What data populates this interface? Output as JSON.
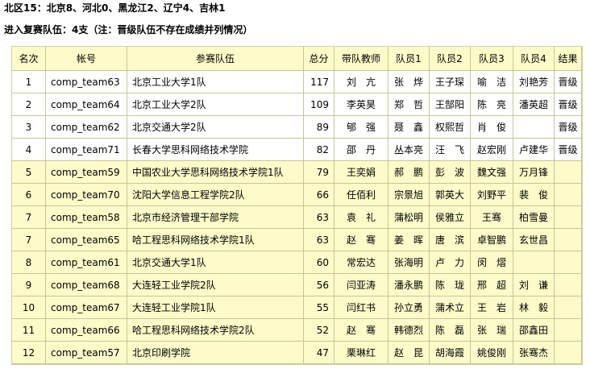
{
  "header": {
    "region_line": "北区15：北京8、河北0、黑龙江2、辽宁4、吉林1",
    "advance_line": "进入复赛队伍：4支（注：晋级队伍不存在成绩并列情况）"
  },
  "table": {
    "columns": [
      "名次",
      "帐号",
      "参赛队伍",
      "总分",
      "带队教师",
      "队员1",
      "队员2",
      "队员3",
      "队员4",
      "结果"
    ],
    "rows": [
      {
        "rank": "1",
        "account": "comp_team63",
        "team": "北京工业大学1队",
        "score": "117",
        "teacher": "刘　亢",
        "m1": "张　烨",
        "m2": "王子琛",
        "m3": "喻　洁",
        "m4": "刘艳芳",
        "result": "晋级",
        "advanced": true
      },
      {
        "rank": "2",
        "account": "comp_team64",
        "team": "北京工业大学2队",
        "score": "109",
        "teacher": "李英昊",
        "m1": "郑　哲",
        "m2": "王郜阳",
        "m3": "陈　亮",
        "m4": "潘英超",
        "result": "晋级",
        "advanced": true
      },
      {
        "rank": "3",
        "account": "comp_team62",
        "team": "北京交通大学2队",
        "score": "89",
        "teacher": "郇　强",
        "m1": "聂　鑫",
        "m2": "权熙哲",
        "m3": "肖　俊",
        "m4": "",
        "result": "晋级",
        "advanced": true
      },
      {
        "rank": "4",
        "account": "comp_team71",
        "team": "长春大学思科网络技术学院",
        "score": "82",
        "teacher": "邵　丹",
        "m1": "丛本亮",
        "m2": "汪　飞",
        "m3": "赵宏刚",
        "m4": "卢建华",
        "result": "晋级",
        "advanced": true
      },
      {
        "rank": "5",
        "account": "comp_team59",
        "team": "中国农业大学思科网络技术学院1队",
        "score": "79",
        "teacher": "王奕娟",
        "m1": "郝　鹏",
        "m2": "彭　波",
        "m3": "魏文强",
        "m4": "万月锋",
        "result": "",
        "advanced": false
      },
      {
        "rank": "6",
        "account": "comp_team70",
        "team": "沈阳大学信息工程学院2队",
        "score": "66",
        "teacher": "任佰利",
        "m1": "宗景旭",
        "m2": "郭英大",
        "m3": "刘野平",
        "m4": "裴　俊",
        "result": "",
        "advanced": false
      },
      {
        "rank": "7",
        "account": "comp_team58",
        "team": "北京市经济管理干部学院",
        "score": "63",
        "teacher": "袁　礼",
        "m1": "蒲松明",
        "m2": "侯雅立",
        "m3": "王骞",
        "m4": "柏雪曼",
        "result": "",
        "advanced": false
      },
      {
        "rank": "7",
        "account": "comp_team65",
        "team": "哈工程思科网络技术学院1队",
        "score": "63",
        "teacher": "赵　骞",
        "m1": "姜　晖",
        "m2": "唐　滨",
        "m3": "卓智鹏",
        "m4": "玄世昌",
        "result": "",
        "advanced": false
      },
      {
        "rank": "8",
        "account": "comp_team61",
        "team": "北京交通大学1队",
        "score": "60",
        "teacher": "常宏达",
        "m1": "张海明",
        "m2": "卢　力",
        "m3": "闵　熠",
        "m4": "",
        "result": "",
        "advanced": false
      },
      {
        "rank": "9",
        "account": "comp_team68",
        "team": "大连轻工业学院2队",
        "score": "56",
        "teacher": "闫亚涛",
        "m1": "潘永鹏",
        "m2": "陈　珑",
        "m3": "邢　超",
        "m4": "刘　谦",
        "result": "",
        "advanced": false
      },
      {
        "rank": "10",
        "account": "comp_team67",
        "team": "大连轻工业学院1队",
        "score": "55",
        "teacher": "闫红书",
        "m1": "孙立勇",
        "m2": "蒲术立",
        "m3": "王　岩",
        "m4": "林　毅",
        "result": "",
        "advanced": false
      },
      {
        "rank": "11",
        "account": "comp_team66",
        "team": "哈工程思科网络技术学院2队",
        "score": "52",
        "teacher": "赵　骞",
        "m1": "韩德烈",
        "m2": "陈　磊",
        "m3": "张　瑞",
        "m4": "邵鑫田",
        "result": "",
        "advanced": false
      },
      {
        "rank": "12",
        "account": "comp_team57",
        "team": "北京印刷学院",
        "score": "47",
        "teacher": "栗琳红",
        "m1": "赵　昆",
        "m2": "胡海霞",
        "m3": "姚俊刚",
        "m4": "张骞杰",
        "result": "",
        "advanced": false
      }
    ]
  }
}
